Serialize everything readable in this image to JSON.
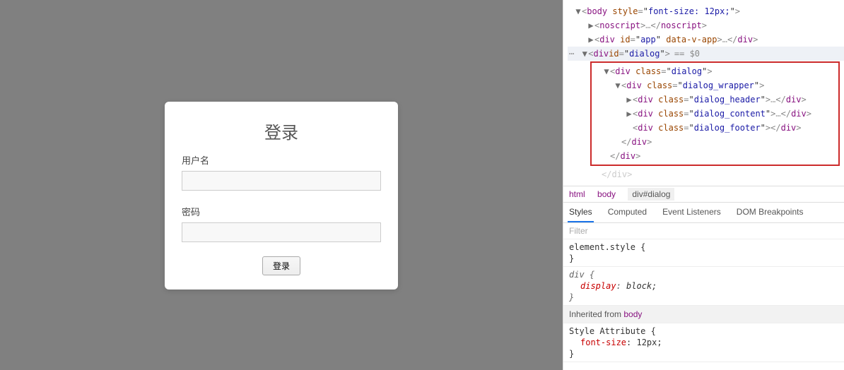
{
  "dialog": {
    "title": "登录",
    "username_label": "用户名",
    "username_value": "",
    "password_label": "密码",
    "password_value": "",
    "submit_label": "登录"
  },
  "devtools": {
    "elements": {
      "body_open": "<body style=\"font-size: 12px;\">",
      "noscript": "<noscript>…</noscript>",
      "app_div": "<div id=\"app\" data-v-app>…</div>",
      "dialog_open": "<div id=\"dialog\">",
      "eq0": "== $0",
      "dialog_class": "<div class=\"dialog\">",
      "wrapper": "<div class=\"dialog_wrapper\">",
      "header": "<div class=\"dialog_header\">…</div>",
      "content": "<div class=\"dialog_content\">…</div>",
      "footer": "<div class=\"dialog_footer\"></div>",
      "close_div1": "</div>",
      "close_div2": "</div>",
      "close_div3": "</div>"
    },
    "breadcrumb": {
      "html": "html",
      "body": "body",
      "sel": "div#dialog"
    },
    "styletabs": {
      "styles": "Styles",
      "computed": "Computed",
      "listeners": "Event Listeners",
      "dom": "DOM Breakpoints"
    },
    "filter_placeholder": "Filter",
    "rules": {
      "element_style": "element.style {",
      "brace_close": "}",
      "div_sel": "div {",
      "display_prop": "display",
      "display_val": "block;",
      "inherited_from": "Inherited from ",
      "inherited_body": "body",
      "style_attr": "Style Attribute {",
      "font_prop": "font-size",
      "font_val": "12px;"
    }
  }
}
